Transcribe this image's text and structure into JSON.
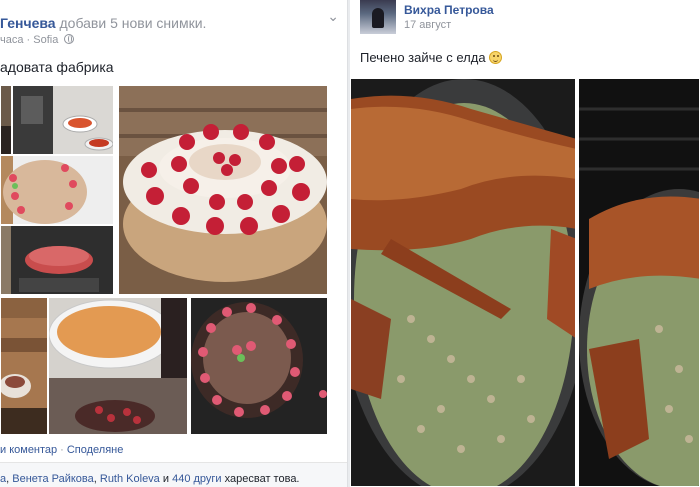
{
  "left_post": {
    "author": "Генчева",
    "action": "добави 5 нови снимки.",
    "time": "часа",
    "location": "Sofia",
    "caption": "адовата фабрика",
    "actions": [
      "и коментар",
      "Споделяне"
    ],
    "likes": {
      "people": [
        "а",
        "Венета Райкова",
        "Ruth Koleva"
      ],
      "others": "440 други",
      "connector": "и",
      "suffix": "харесват това."
    }
  },
  "right_post": {
    "author": "Вихра Петрова",
    "date": "17 август",
    "caption": "Печено зайче с елда"
  },
  "colors": {
    "link": "#365899",
    "meta": "#90949c",
    "text": "#1d2129"
  }
}
